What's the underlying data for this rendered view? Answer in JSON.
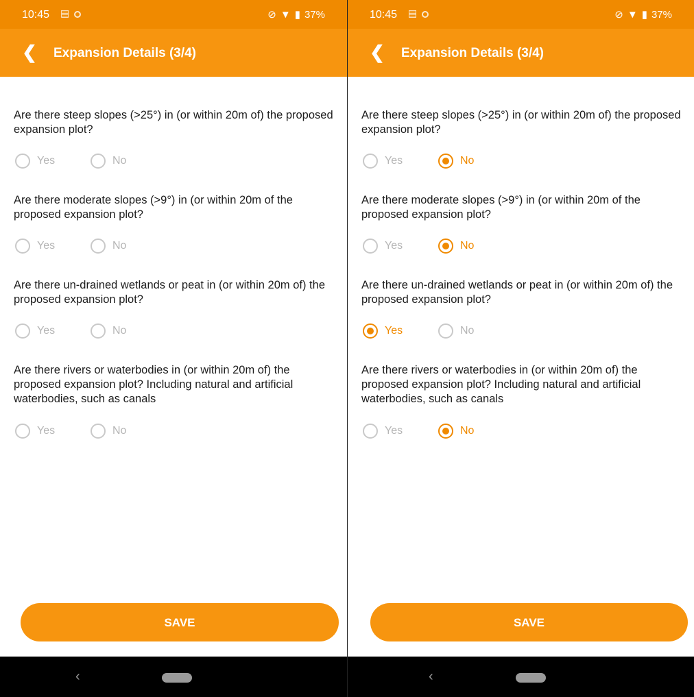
{
  "colors": {
    "accent": "#f7950f",
    "statusbar": "#f08a00",
    "radio_unchecked": "#c9c9c9",
    "nav": "#000000"
  },
  "screens": [
    {
      "status": {
        "time": "10:45",
        "battery": "37%"
      },
      "header": {
        "back_icon": "chevron-left-icon",
        "title": "Expansion Details (3/4)"
      },
      "questions": [
        {
          "text": "Are there steep slopes (>25°) in (or within 20m of) the proposed expansion plot?",
          "yes_label": "Yes",
          "no_label": "No",
          "selected": null
        },
        {
          "text": "Are there moderate slopes (>9°) in (or within 20m of the proposed expansion plot?",
          "yes_label": "Yes",
          "no_label": "No",
          "selected": null
        },
        {
          "text": "Are there un-drained wetlands or peat in (or within 20m of) the proposed expansion plot?",
          "yes_label": "Yes",
          "no_label": "No",
          "selected": null
        },
        {
          "text": "Are there rivers or waterbodies in (or within 20m of) the proposed expansion plot? Including natural and artificial waterbodies, such as canals",
          "yes_label": "Yes",
          "no_label": "No",
          "selected": null
        }
      ],
      "save_label": "SAVE"
    },
    {
      "status": {
        "time": "10:45",
        "battery": "37%"
      },
      "header": {
        "back_icon": "chevron-left-icon",
        "title": "Expansion Details (3/4)"
      },
      "questions": [
        {
          "text": "Are there steep slopes (>25°) in (or within 20m of) the proposed expansion plot?",
          "yes_label": "Yes",
          "no_label": "No",
          "selected": "No"
        },
        {
          "text": "Are there moderate slopes (>9°) in (or within 20m of the proposed expansion plot?",
          "yes_label": "Yes",
          "no_label": "No",
          "selected": "No"
        },
        {
          "text": "Are there un-drained wetlands or peat in (or within 20m of) the proposed expansion plot?",
          "yes_label": "Yes",
          "no_label": "No",
          "selected": "Yes"
        },
        {
          "text": "Are there rivers or waterbodies in (or within 20m of) the proposed expansion plot? Including natural and artificial waterbodies, such as canals",
          "yes_label": "Yes",
          "no_label": "No",
          "selected": "No"
        }
      ],
      "save_label": "SAVE"
    }
  ]
}
